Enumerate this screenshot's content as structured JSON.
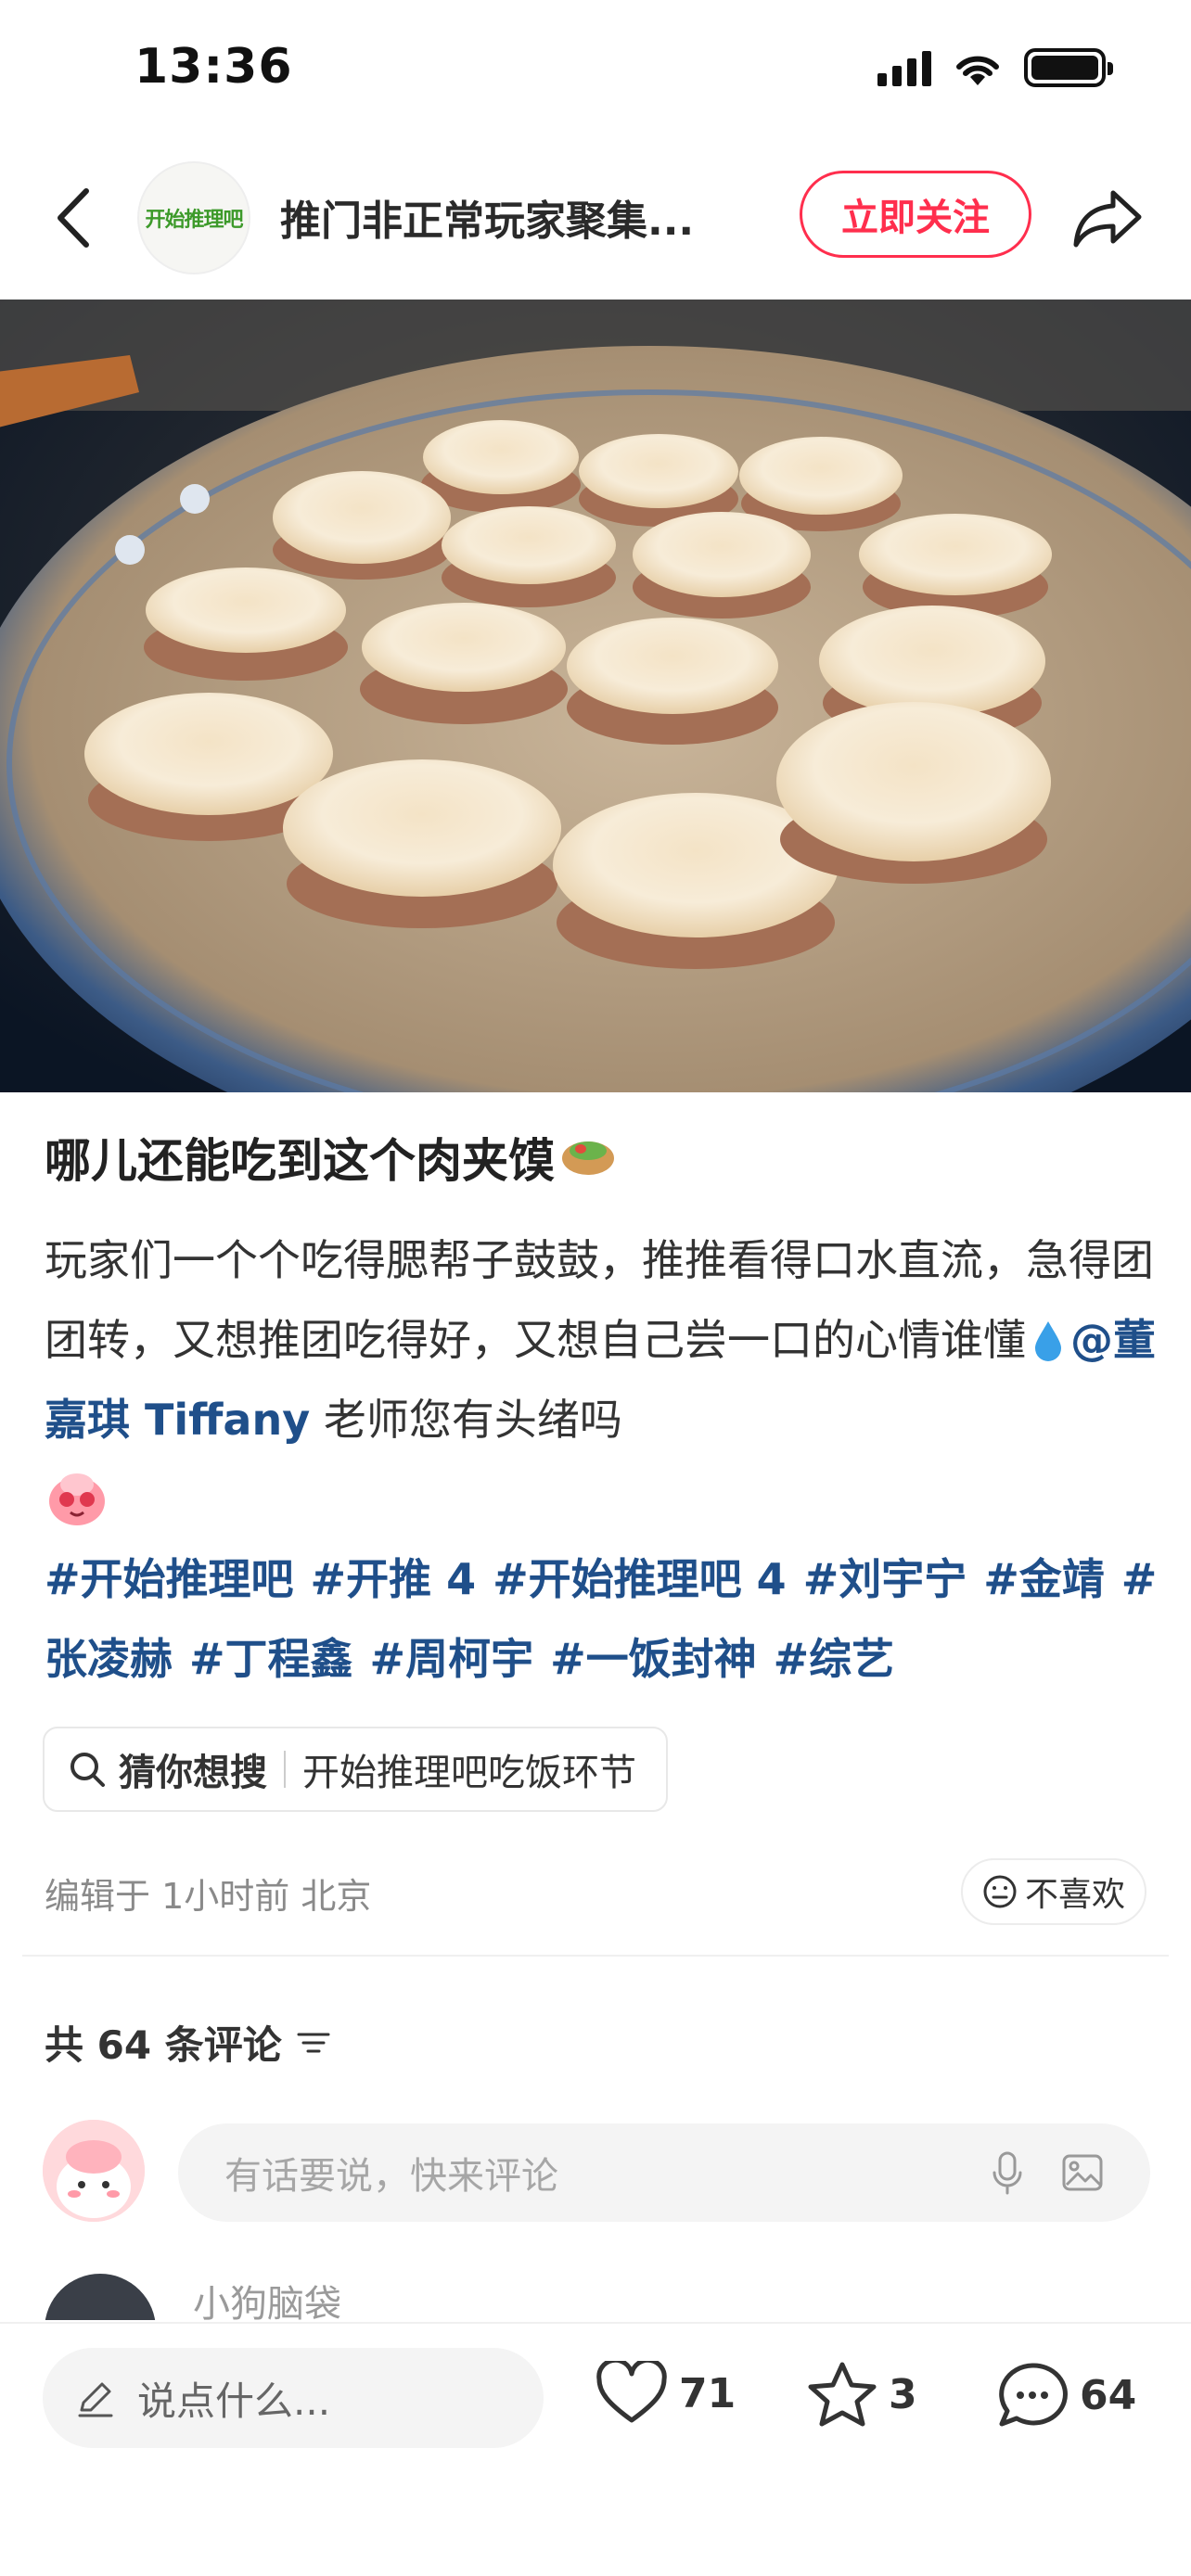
{
  "status_bar": {
    "time": "13:36"
  },
  "header": {
    "channel_logo_text": "开始推理吧",
    "channel_name": "推门非正常玩家聚集...",
    "follow_label": "立即关注"
  },
  "post": {
    "title": "哪儿还能吃到这个肉夹馍",
    "body_text": "玩家们一个个吃得腮帮子鼓鼓，推推看得口水直流，急得团团转，又想推团吃得好，又想自己尝一口的心情谁懂",
    "mention": "@董嘉琪 Tiffany",
    "body_tail": " 老师您有头绪吗",
    "hashtags": [
      "#开始推理吧",
      "#开推 4",
      "#开始推理吧 4",
      "#刘宇宁",
      "#金靖",
      "#张凌赫",
      "#丁程鑫",
      "#周柯宇",
      "#一饭封神",
      "#综艺"
    ]
  },
  "search_chip": {
    "label": "猜你想搜",
    "query": "开始推理吧吃饭环节"
  },
  "meta": {
    "edited": "编辑于 1小时前 北京",
    "dislike_label": "不喜欢"
  },
  "comments": {
    "count_label": "共 64 条评论",
    "input_placeholder": "有话要说，快来评论",
    "preview_name": "小狗脑袋"
  },
  "bottom_bar": {
    "say_placeholder": "说点什么...",
    "likes": "71",
    "stars": "3",
    "comments": "64"
  },
  "colors": {
    "accent": "#ff2e4d",
    "link": "#1f4f8a"
  }
}
